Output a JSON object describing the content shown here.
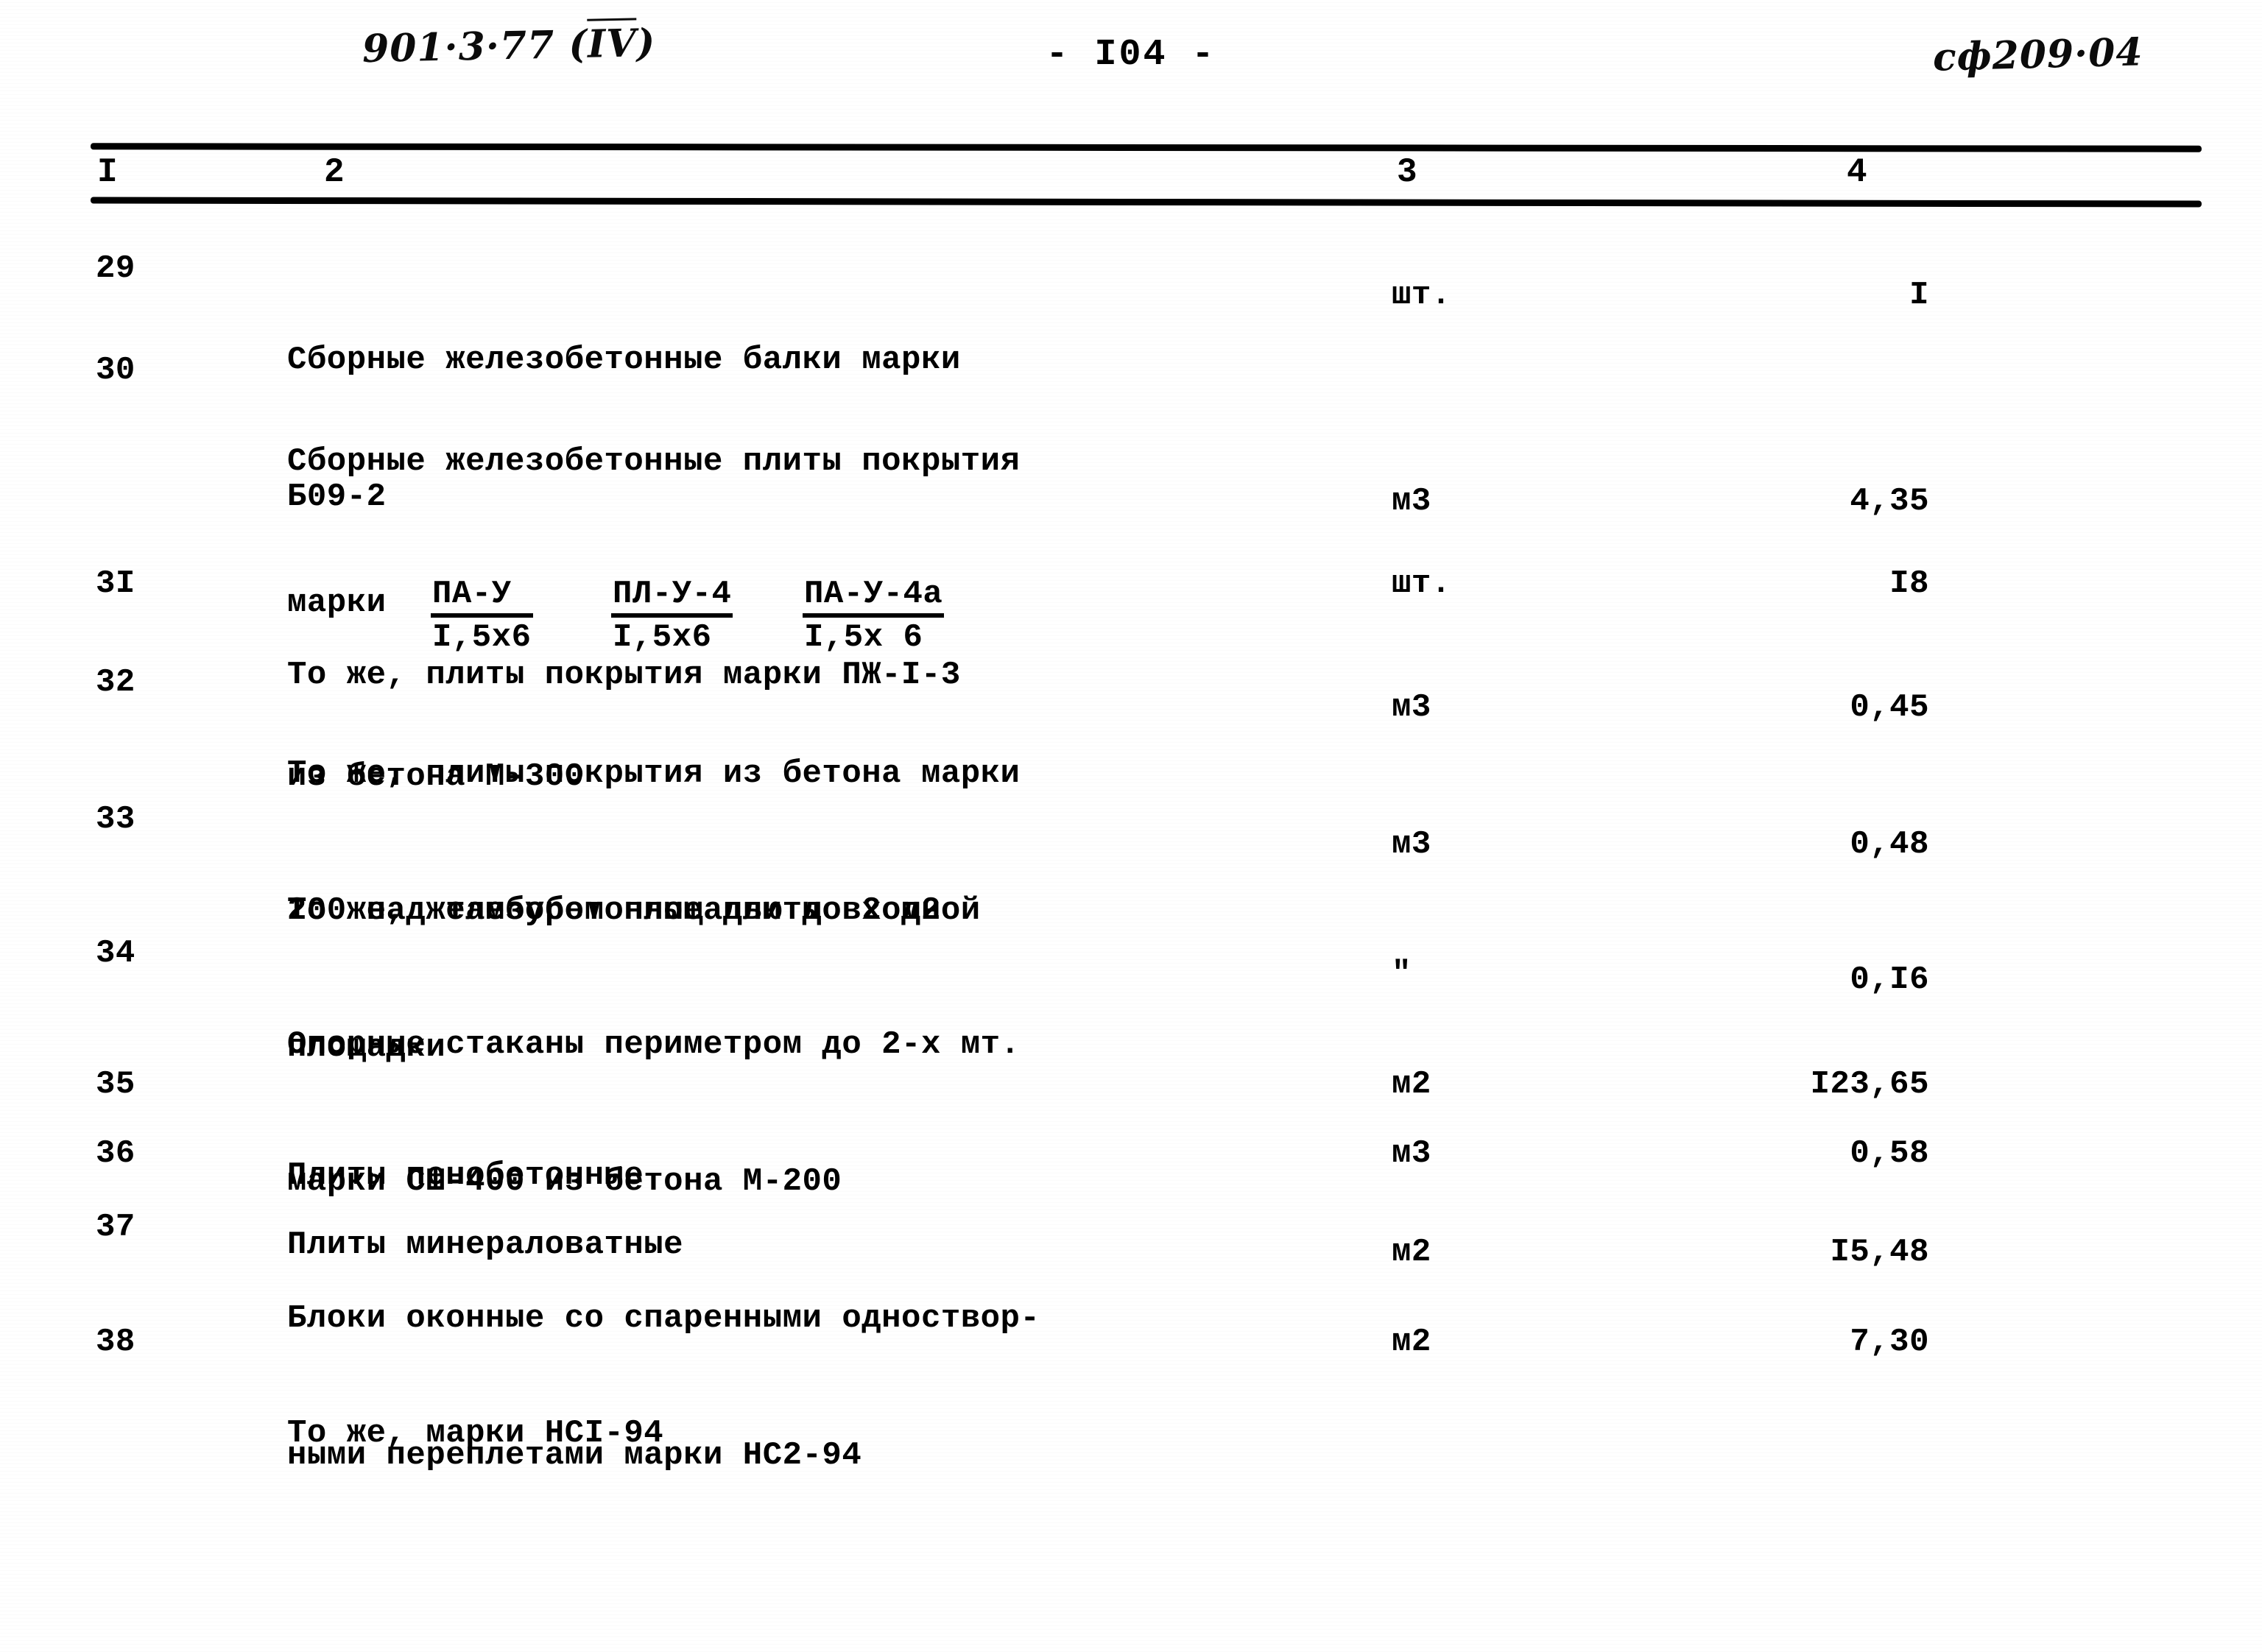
{
  "page": {
    "folio": "- I04 -",
    "handwritten_left": "901·3·77 (IV)",
    "handwritten_left_overline": "IV",
    "handwritten_left_prefix": "901·3·77 (",
    "handwritten_left_suffix": ")",
    "handwritten_right": "сф209·04"
  },
  "table": {
    "column_headers": [
      "I",
      "2",
      "3",
      "4"
    ],
    "rows": [
      {
        "num": "29",
        "desc_lines": [
          "Сборные железобетонные балки марки",
          "Б09-2"
        ],
        "unit": "шт.",
        "qty": "I"
      },
      {
        "num": "30",
        "desc_lines": [
          "Сборные железобетонные плиты покрытия"
        ],
        "fraction_lead": "марки",
        "fractions": [
          {
            "numerator": "ПА-У",
            "denominator": "I,5х6"
          },
          {
            "numerator": "ПЛ-У-4",
            "denominator": "I,5х6"
          },
          {
            "numerator": "ПА-У-4а",
            "denominator": "I,5х 6"
          }
        ],
        "desc_tail": [
          "из бетона М-300"
        ],
        "unit": "м3",
        "qty": "4,35"
      },
      {
        "num": "3I",
        "desc_lines": [
          "То же, плиты покрытия марки ПЖ-I-3"
        ],
        "unit": "шт.",
        "qty": "I8"
      },
      {
        "num": "32",
        "desc_lines": [
          "То же, плиты покрытия из бетона марки",
          "200 над тамбуром площадью до 2 м2"
        ],
        "unit": "м3",
        "qty": "0,45"
      },
      {
        "num": "33",
        "desc_lines": [
          "То же, железобетонные плиты входной",
          "площадки"
        ],
        "unit": "м3",
        "qty": "0,48"
      },
      {
        "num": "34",
        "desc_lines": [
          "Опорные стаканы периметром до 2-х мт.",
          "марки СШ-400 из бетона М-200"
        ],
        "unit": "\"",
        "qty": "0,I6"
      },
      {
        "num": "35",
        "desc_lines": [
          "Плиты пенобетонные"
        ],
        "unit": "м2",
        "qty": "I23,65"
      },
      {
        "num": "36",
        "desc_lines": [
          "Плиты минераловатные"
        ],
        "unit": "м3",
        "qty": "0,58"
      },
      {
        "num": "37",
        "desc_lines": [
          "Блоки оконные со спаренными одноствор-",
          "ными переплетами марки НС2-94"
        ],
        "unit": "м2",
        "qty": "I5,48"
      },
      {
        "num": "38",
        "desc_lines": [
          "То же, марки НСI-94"
        ],
        "unit": "м2",
        "qty": "7,30"
      }
    ]
  },
  "colors": {
    "ink": "#000000",
    "paper": "#ffffff"
  }
}
